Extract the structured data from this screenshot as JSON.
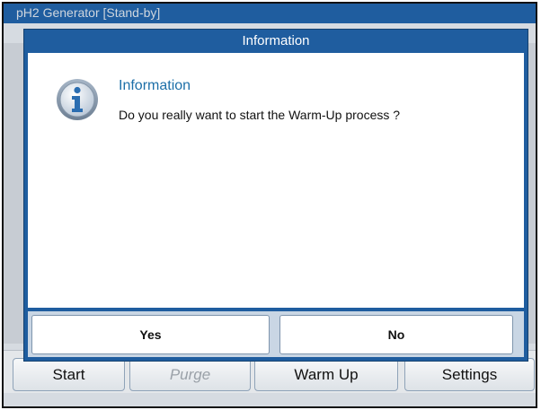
{
  "window": {
    "title": "pH2 Generator  [Stand-by]"
  },
  "toolbar": {
    "buttons": [
      {
        "label": "Start",
        "enabled": true
      },
      {
        "label": "Purge",
        "enabled": false
      },
      {
        "label": "Warm Up",
        "enabled": true
      },
      {
        "label": "Settings",
        "enabled": true
      }
    ]
  },
  "dialog": {
    "title": "Information",
    "icon": "info-icon",
    "heading": "Information",
    "message": "Do you really want to start the Warm-Up process ?",
    "yes_label": "Yes",
    "no_label": "No"
  },
  "colors": {
    "accent_blue": "#1f5d9f",
    "heading_blue": "#1d6fa8"
  }
}
